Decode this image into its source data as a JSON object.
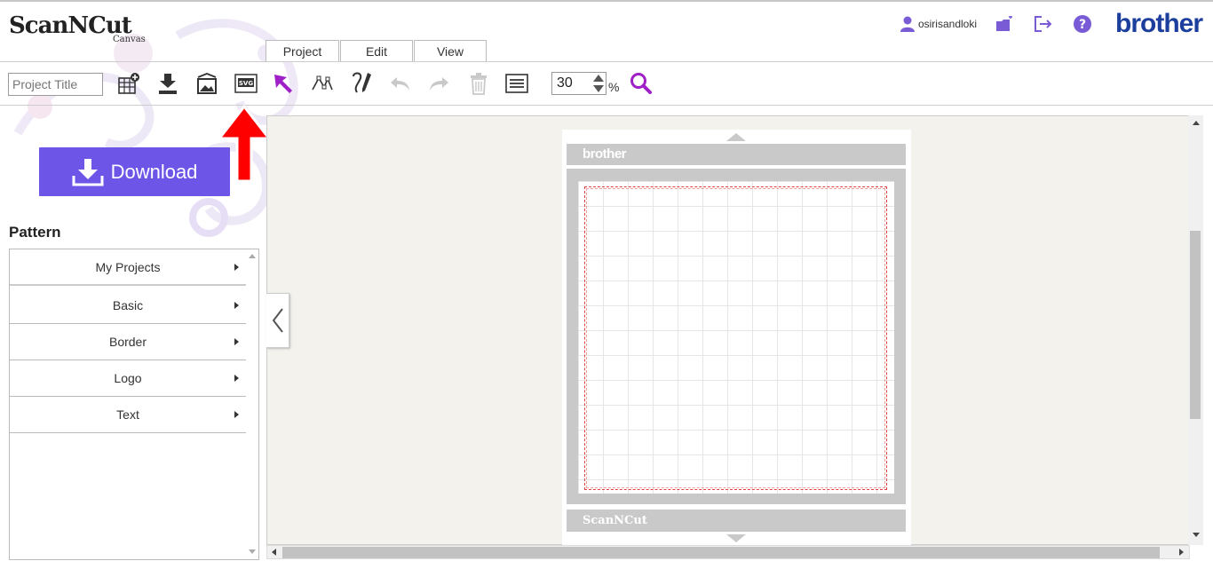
{
  "app": {
    "logo_main": "ScanNCut",
    "logo_sub": "Canvas",
    "brand": "brother"
  },
  "header": {
    "username": "osirisandloki",
    "icons": [
      "user-icon",
      "mycanvas-folder-icon",
      "logout-icon",
      "help-icon"
    ]
  },
  "tabs": [
    {
      "label": "Project"
    },
    {
      "label": "Edit"
    },
    {
      "label": "View"
    }
  ],
  "toolbar": {
    "project_title_placeholder": "Project Title",
    "zoom_value": "30",
    "zoom_unit": "%",
    "icons": [
      "new-project-icon",
      "download-icon",
      "import-image-icon",
      "export-svg-icon",
      "select-arrow-icon",
      "edit-points-icon",
      "draw-pen-icon",
      "undo-icon",
      "redo-icon",
      "delete-icon",
      "properties-list-icon",
      "zoom-search-icon"
    ],
    "svg_label": "SVG"
  },
  "sidebar": {
    "download_label": "Download",
    "pattern_title": "Pattern",
    "items": [
      {
        "label": "My Projects"
      },
      {
        "label": "Basic"
      },
      {
        "label": "Border"
      },
      {
        "label": "Logo"
      },
      {
        "label": "Text"
      }
    ]
  },
  "mat": {
    "brand": "brother",
    "bottom_logo": "ScanNCut"
  },
  "colors": {
    "accent_purple": "#6d55e8",
    "brand_blue": "#1c3f9e",
    "annotation_red": "#ff0000",
    "icon_purple": "#7a5bd6"
  }
}
